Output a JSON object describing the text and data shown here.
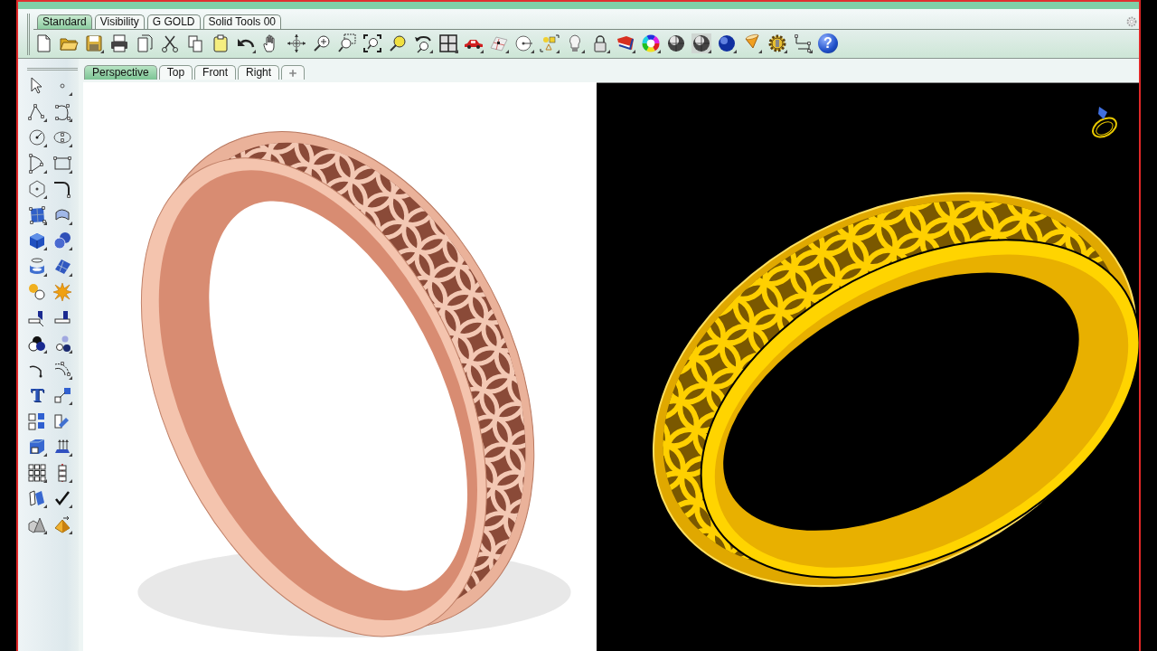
{
  "toolbar": {
    "tabs": [
      {
        "label": "Standard",
        "selected": true
      },
      {
        "label": "Visibility",
        "selected": false
      },
      {
        "label": "G GOLD",
        "selected": false
      },
      {
        "label": "Solid Tools 00",
        "selected": false
      }
    ],
    "help_glyph": "?"
  },
  "viewport_tabs": [
    {
      "label": "Perspective",
      "selected": true
    },
    {
      "label": "Top",
      "selected": false
    },
    {
      "label": "Front",
      "selected": false
    },
    {
      "label": "Right",
      "selected": false
    }
  ],
  "sidebar": {
    "text_glyph": "T"
  }
}
